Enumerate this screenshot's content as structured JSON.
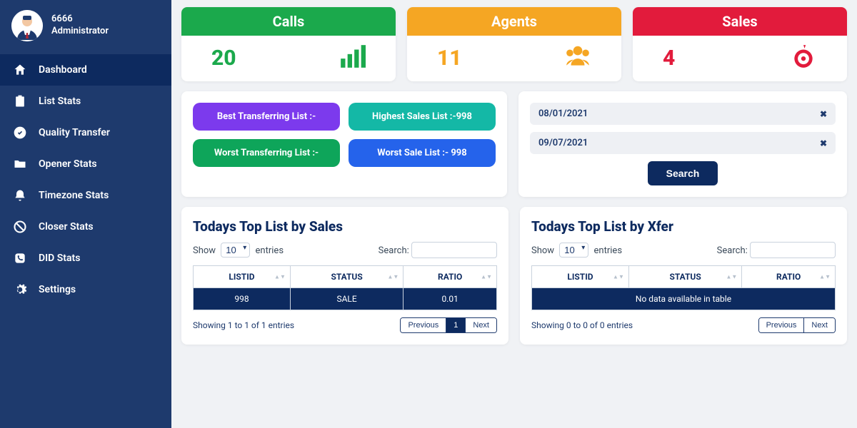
{
  "profile": {
    "id": "6666",
    "role": "Administrator"
  },
  "nav": {
    "dashboard": "Dashboard",
    "list_stats": "List Stats",
    "quality_transfer": "Quality Transfer",
    "opener_stats": "Opener Stats",
    "timezone_stats": "Timezone Stats",
    "closer_stats": "Closer Stats",
    "did_stats": "DID Stats",
    "settings": "Settings"
  },
  "kpi": {
    "calls": {
      "title": "Calls",
      "value": "20"
    },
    "agents": {
      "title": "Agents",
      "value": "11"
    },
    "sales": {
      "title": "Sales",
      "value": "4"
    }
  },
  "filters": {
    "best_transfer": "Best Transferring List :-",
    "highest_sales": "Highest Sales List :-998",
    "worst_transfer": "Worst Transferring List :-",
    "worst_sale": "Worst Sale List :- 998"
  },
  "dates": {
    "from": "08/01/2021",
    "to": "09/07/2021",
    "search_label": "Search"
  },
  "tables": {
    "show_label": "Show",
    "entries_label": "entries",
    "search_label": "Search:",
    "page_size": "10",
    "cols": {
      "listid": "LISTID",
      "status": "STATUS",
      "ratio": "RATIO"
    },
    "prev": "Previous",
    "next": "Next",
    "page1": "1"
  },
  "sales_table": {
    "title": "Todays Top List by Sales",
    "row": {
      "listid": "998",
      "status": "SALE",
      "ratio": "0.01"
    },
    "footer": "Showing 1 to 1 of 1 entries"
  },
  "xfer_table": {
    "title": "Todays Top List by Xfer",
    "empty": "No data available in table",
    "footer": "Showing 0 to 0 of 0 entries"
  }
}
